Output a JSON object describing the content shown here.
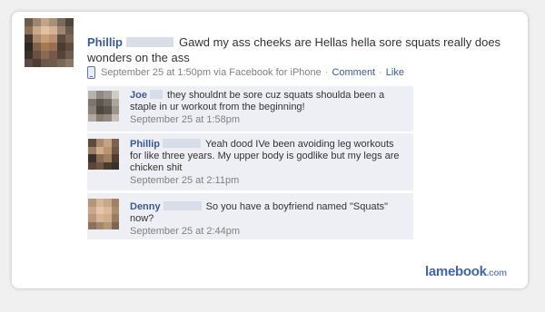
{
  "post": {
    "author": "Phillip",
    "text": "Gawd my ass cheeks are Hellas hella sore squats really does wonders on the ass",
    "timestamp": "September 25 at 1:50pm via Facebook for iPhone",
    "comment_link": "Comment",
    "like_link": "Like",
    "separator": "·",
    "device_icon": "phone-icon",
    "avatar_colors": [
      "#6b5a4a",
      "#9d8470",
      "#c2a588",
      "#a88f78",
      "#7a6a5c",
      "#514538",
      "#8a7058",
      "#caa98a",
      "#e0c2a3",
      "#d3b394",
      "#9c8672",
      "#6a5a4d",
      "#43372e",
      "#aa8b6c",
      "#c89e78",
      "#b89172",
      "#5c4b3f",
      "#7c6555",
      "#2f2620",
      "#7e6249",
      "#a47a54",
      "#9a6f4f",
      "#4c3b30",
      "#5e4c40",
      "#3c3029",
      "#6a5142",
      "#8b6a51",
      "#75594a",
      "#54443a",
      "#6f5c4f",
      "#5a4a3f",
      "#4b3d33",
      "#6b5849",
      "#6e5b4c",
      "#7a6757",
      "#8c7867"
    ]
  },
  "comments": [
    {
      "author": "Joe",
      "text": "they shouldnt be sore cuz squats shoulda been a staple in ur workout from the beginning!",
      "timestamp": "September 25 at 1:58pm",
      "avatar_colors": [
        "#b6b3ad",
        "#8e8982",
        "#9d9a94",
        "#cfccc6",
        "#7c766e",
        "#5d574f",
        "#6e6961",
        "#a9a59f",
        "#8a8177",
        "#4f463d",
        "#5c534b",
        "#9a948c",
        "#b0a89d",
        "#867c70",
        "#91887e",
        "#c3bdb4"
      ]
    },
    {
      "author": "Phillip",
      "text": "Yeah dood IVe been avoiding leg workouts for like three years. My upper body is godlike but my legs are chicken shit",
      "timestamp": "September 25 at 2:11pm",
      "avatar_colors": [
        "#5e4a3b",
        "#a88a6c",
        "#c5a382",
        "#7a634f",
        "#9b7e63",
        "#d0ad8a",
        "#b8946f",
        "#6f5845",
        "#3d3029",
        "#8b6d54",
        "#a07e60",
        "#4f3d31",
        "#5a4739",
        "#6e5646",
        "#4b3a2e",
        "#3c2f27"
      ]
    },
    {
      "author": "Denny",
      "text": "So you have a boyfriend named \"Squats\" now?",
      "timestamp": "September 25 at 2:44pm",
      "avatar_colors": [
        "#b49677",
        "#d3b597",
        "#c8a889",
        "#9e8266",
        "#caa788",
        "#e4c6a6",
        "#d9b998",
        "#ab8c6e",
        "#b9987a",
        "#d6b596",
        "#cfae8e",
        "#9a7c61",
        "#8e7159",
        "#a4866b",
        "#b5967a",
        "#7d6550"
      ]
    }
  ],
  "watermark": {
    "brand": "lamebook",
    "tld": ".com"
  }
}
